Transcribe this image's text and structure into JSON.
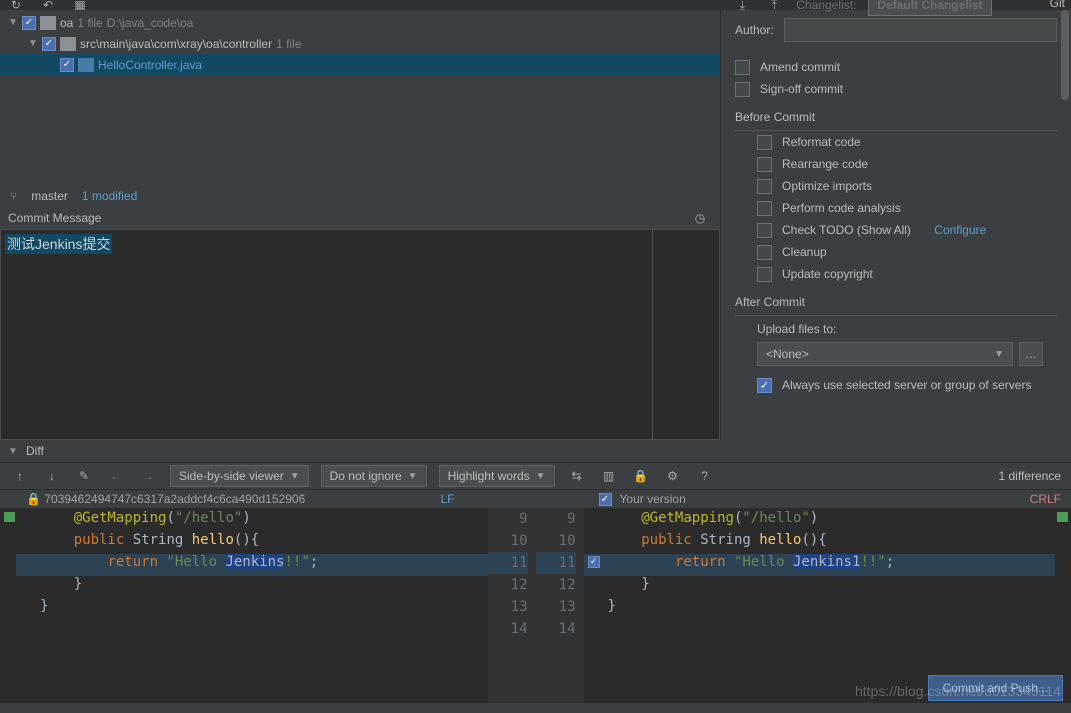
{
  "toolbar": {
    "changelist_label": "Changelist:",
    "changelist_value": "Default Changelist"
  },
  "tree": {
    "root": {
      "name": "oa",
      "count": "1 file",
      "path": "D:\\java_code\\oa"
    },
    "pkg": {
      "path": "src\\main\\java\\com\\xray\\oa\\controller",
      "count": "1 file"
    },
    "file": {
      "name": "HelloController.java"
    }
  },
  "branch": {
    "name": "master",
    "modified": "1 modified"
  },
  "commit_message": {
    "title": "Commit Message",
    "text": "测试Jenkins提交"
  },
  "git": {
    "header": "Git",
    "author_label": "Author:",
    "amend": "Amend commit",
    "signoff": "Sign-off commit",
    "before": "Before Commit",
    "reformat": "Reformat code",
    "rearrange": "Rearrange code",
    "optimize": "Optimize imports",
    "analysis": "Perform code analysis",
    "todo": "Check TODO (Show All)",
    "configure": "Configure",
    "cleanup": "Cleanup",
    "copyright": "Update copyright",
    "after": "After Commit",
    "upload_label": "Upload files to:",
    "upload_value": "<None>",
    "always": "Always use selected server or group of servers"
  },
  "diff": {
    "title": "Diff",
    "viewer": "Side-by-side viewer",
    "ignore": "Do not ignore",
    "highlight": "Highlight words",
    "summary": "1 difference",
    "left_rev": "7039462494747c6317a2addcf4c6ca490d152906",
    "left_eol": "LF",
    "right_label": "Your version",
    "right_eol": "CRLF",
    "lines": {
      "r9": "9",
      "r10": "10",
      "r11": "11",
      "r12": "12",
      "r13": "13",
      "r14": "14"
    },
    "code": {
      "l1a": "@GetMapping",
      "l1b": "(",
      "l1c": "\"/hello\"",
      "l1d": ")",
      "l2a": "public ",
      "l2b": "String ",
      "l2c": "hello",
      "l2d": "(){",
      "l3a": "return ",
      "l3b": "\"Hello ",
      "l3c_left": "Jenkins",
      "l3c_right": "Jenkins1",
      "l3d": "!!\"",
      "l3e": ";",
      "l4": "    }",
      "l5": "}"
    }
  },
  "buttons": {
    "commit_push": "Commit and Push..."
  },
  "watermark": "https://blog.csdn.net/u013343114"
}
